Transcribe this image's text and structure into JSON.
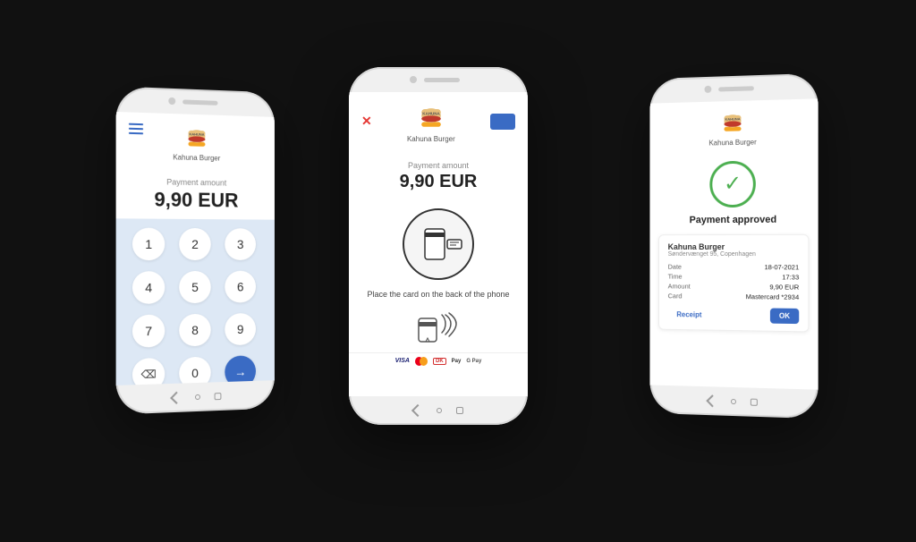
{
  "left_phone": {
    "menu_label": "Menu",
    "logo_text": "Kahuna Burger",
    "payment_label": "Payment amount",
    "payment_value": "9,90 EUR",
    "keys": [
      "1",
      "2",
      "3",
      "4",
      "5",
      "6",
      "7",
      "8",
      "9",
      "⌫",
      "0",
      "→"
    ]
  },
  "center_phone": {
    "logo_text": "Kahuna Burger",
    "payment_label": "Payment amount",
    "payment_value": "9,90 EUR",
    "place_card_text": "Place the card on the back of the phone",
    "payment_methods": [
      "VISA",
      "MC",
      "DK",
      "Apple Pay",
      "G Pay"
    ]
  },
  "right_phone": {
    "logo_text": "Kahuna Burger",
    "approved_text": "Payment approved",
    "receipt": {
      "title": "Kahuna Burger",
      "address": "Søndervænget 95, Copenhagen",
      "date_label": "Date",
      "date_value": "18-07-2021",
      "time_label": "Time",
      "time_value": "17:33",
      "amount_label": "Amount",
      "amount_value": "9,90 EUR",
      "card_label": "Card",
      "card_value": "Mastercard *2934",
      "btn_receipt": "Receipt",
      "btn_ok": "OK"
    }
  }
}
